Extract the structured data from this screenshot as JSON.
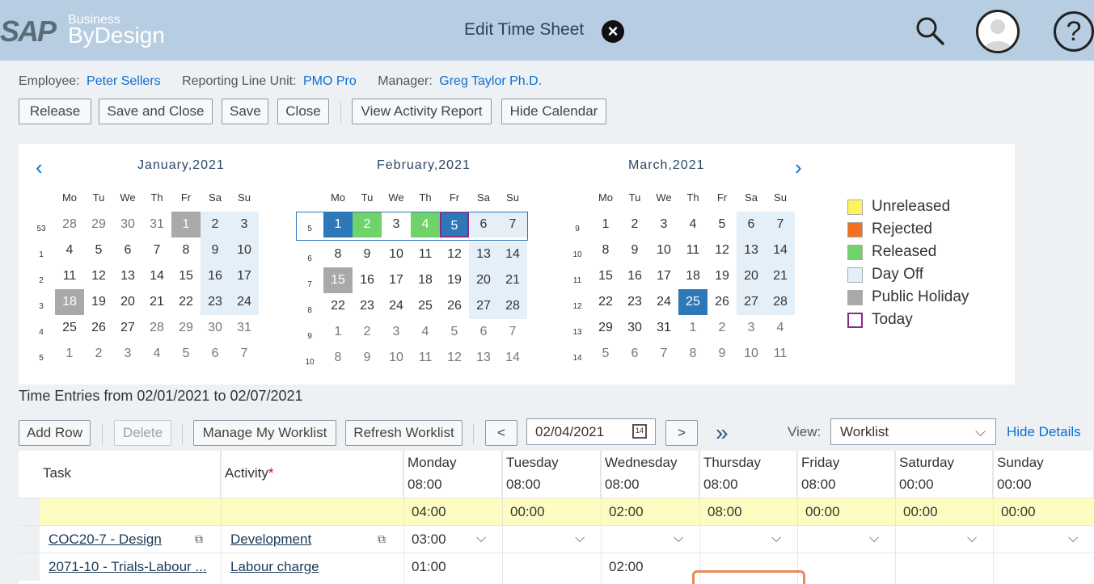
{
  "shell": {
    "logo_sap": "SAP",
    "logo_business": "Business",
    "logo_bydesign": "ByDesign",
    "title": "Edit Time Sheet"
  },
  "info": {
    "employee_label": "Employee:",
    "employee": "Peter Sellers",
    "unit_label": "Reporting Line Unit:",
    "unit": "PMO Pro",
    "manager_label": "Manager:",
    "manager": "Greg Taylor Ph.D."
  },
  "toolbar": {
    "release": "Release",
    "save_close": "Save and Close",
    "save": "Save",
    "close": "Close",
    "view_activity": "View Activity Report",
    "hide_calendar": "Hide Calendar"
  },
  "calendar": {
    "dow": [
      "Mo",
      "Tu",
      "We",
      "Th",
      "Fr",
      "Sa",
      "Su"
    ],
    "months": [
      {
        "title": "January,2021",
        "weeks": [
          {
            "wk": "53",
            "days": [
              "28",
              "29",
              "30",
              "31",
              "1",
              "2",
              "3"
            ]
          },
          {
            "wk": "1",
            "days": [
              "4",
              "5",
              "6",
              "7",
              "8",
              "9",
              "10"
            ]
          },
          {
            "wk": "2",
            "days": [
              "11",
              "12",
              "13",
              "14",
              "15",
              "16",
              "17"
            ]
          },
          {
            "wk": "3",
            "days": [
              "18",
              "19",
              "20",
              "21",
              "22",
              "23",
              "24"
            ]
          },
          {
            "wk": "4",
            "days": [
              "25",
              "26",
              "27",
              "28",
              "29",
              "30",
              "31"
            ]
          },
          {
            "wk": "5",
            "days": [
              "1",
              "2",
              "3",
              "4",
              "5",
              "6",
              "7"
            ]
          }
        ]
      },
      {
        "title": "February,2021",
        "weeks": [
          {
            "wk": "5",
            "days": [
              "1",
              "2",
              "3",
              "4",
              "5",
              "6",
              "7"
            ]
          },
          {
            "wk": "6",
            "days": [
              "8",
              "9",
              "10",
              "11",
              "12",
              "13",
              "14"
            ]
          },
          {
            "wk": "7",
            "days": [
              "15",
              "16",
              "17",
              "18",
              "19",
              "20",
              "21"
            ]
          },
          {
            "wk": "8",
            "days": [
              "22",
              "23",
              "24",
              "25",
              "26",
              "27",
              "28"
            ]
          },
          {
            "wk": "9",
            "days": [
              "1",
              "2",
              "3",
              "4",
              "5",
              "6",
              "7"
            ]
          },
          {
            "wk": "10",
            "days": [
              "8",
              "9",
              "10",
              "11",
              "12",
              "13",
              "14"
            ]
          }
        ]
      },
      {
        "title": "March,2021",
        "weeks": [
          {
            "wk": "9",
            "days": [
              "1",
              "2",
              "3",
              "4",
              "5",
              "6",
              "7"
            ]
          },
          {
            "wk": "10",
            "days": [
              "8",
              "9",
              "10",
              "11",
              "12",
              "13",
              "14"
            ]
          },
          {
            "wk": "11",
            "days": [
              "15",
              "16",
              "17",
              "18",
              "19",
              "20",
              "21"
            ]
          },
          {
            "wk": "12",
            "days": [
              "22",
              "23",
              "24",
              "25",
              "26",
              "27",
              "28"
            ]
          },
          {
            "wk": "13",
            "days": [
              "29",
              "30",
              "31",
              "1",
              "2",
              "3",
              "4"
            ]
          },
          {
            "wk": "14",
            "days": [
              "5",
              "6",
              "7",
              "8",
              "9",
              "10",
              "11"
            ]
          }
        ]
      }
    ],
    "legend": [
      {
        "label": "Unreleased",
        "color": "#fff35c"
      },
      {
        "label": "Rejected",
        "color": "#f27020"
      },
      {
        "label": "Released",
        "color": "#6fd26a"
      },
      {
        "label": "Day Off",
        "color": "#e5eff8"
      },
      {
        "label": "Public Holiday",
        "color": "#a9a9a9"
      },
      {
        "label": "Today",
        "color": "#ffffff"
      }
    ]
  },
  "entries": {
    "title": "Time Entries from 02/01/2021 to 02/07/2021",
    "add_row": "Add Row",
    "delete": "Delete",
    "manage_worklist": "Manage My Worklist",
    "refresh_worklist": "Refresh Worklist",
    "prev": "<",
    "next": ">",
    "date": "02/04/2021",
    "view_label": "View:",
    "view_value": "Worklist",
    "hide_details": "Hide Details"
  },
  "table": {
    "col_task": "Task",
    "col_activity": "Activity",
    "required_mark": "*",
    "days": [
      {
        "name": "Monday",
        "hours": "08:00",
        "total": "04:00"
      },
      {
        "name": "Tuesday",
        "hours": "08:00",
        "total": "00:00"
      },
      {
        "name": "Wednesday",
        "hours": "08:00",
        "total": "02:00"
      },
      {
        "name": "Thursday",
        "hours": "08:00",
        "total": "08:00"
      },
      {
        "name": "Friday",
        "hours": "08:00",
        "total": "00:00"
      },
      {
        "name": "Saturday",
        "hours": "00:00",
        "total": "00:00"
      },
      {
        "name": "Sunday",
        "hours": "00:00",
        "total": "00:00"
      }
    ],
    "rows": [
      {
        "task": "COC20-7 - Design",
        "activity": "Development",
        "values": [
          "03:00",
          "",
          "",
          "",
          "",
          "",
          ""
        ]
      },
      {
        "task": "2071-10 - Trials-Labour ...",
        "activity": "Labour charge",
        "values": [
          "01:00",
          "",
          "02:00",
          "",
          "",
          "",
          ""
        ]
      }
    ]
  }
}
